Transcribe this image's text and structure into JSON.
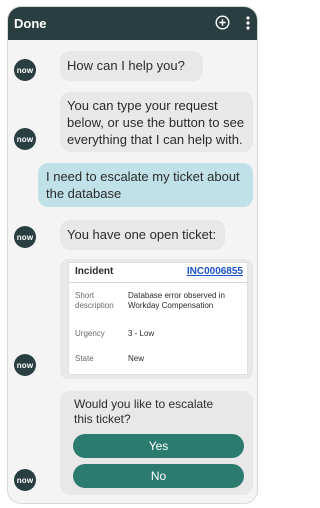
{
  "header": {
    "done_label": "Done",
    "plus_icon": "plus-circle-icon",
    "more_icon": "vertical-ellipsis-icon"
  },
  "avatar_label": "now",
  "messages": {
    "m1": "How can I help you?",
    "m2": "You can type your request below, or use the button to see everything that I can help with.",
    "m3": "I need to escalate my ticket about the database",
    "m4": "You have one open ticket:",
    "m5": "Would you like to escalate this ticket?"
  },
  "ticket": {
    "type": "Incident",
    "number": "INC0006855",
    "fields": [
      {
        "label": "Short description",
        "value": "Database error observed in Workday Compensation"
      },
      {
        "label": "Urgency",
        "value": "3 - Low"
      },
      {
        "label": "State",
        "value": "New"
      }
    ]
  },
  "choices": {
    "yes": "Yes",
    "no": "No"
  },
  "colors": {
    "header_bg": "#293e40",
    "user_bubble": "#bfe1e7",
    "bot_bubble": "#e8e8e8",
    "button": "#2b7b6f",
    "link": "#1a55c8"
  }
}
